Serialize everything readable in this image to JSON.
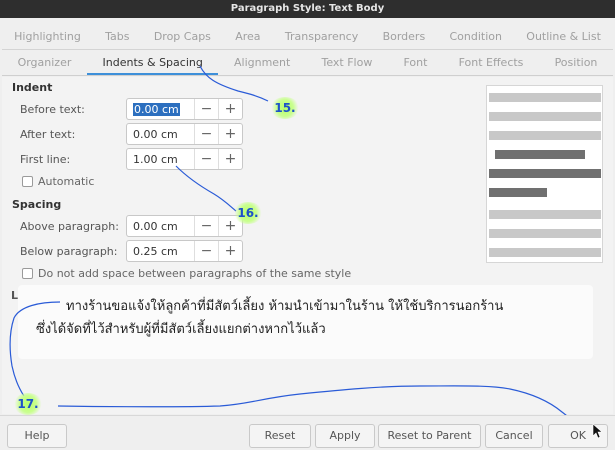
{
  "window": {
    "title": "Paragraph Style: Text Body"
  },
  "tabs_row1": [
    "Highlighting",
    "Tabs",
    "Drop Caps",
    "Area",
    "Transparency",
    "Borders",
    "Condition",
    "Outline & List"
  ],
  "tabs_row2": [
    "Organizer",
    "Indents & Spacing",
    "Alignment",
    "Text Flow",
    "Font",
    "Font Effects",
    "Position"
  ],
  "active_tab": "Indents & Spacing",
  "indent": {
    "heading": "Indent",
    "before_text": {
      "label": "Before text:",
      "value": "0.00 cm"
    },
    "after_text": {
      "label": "After text:",
      "value": "0.00 cm"
    },
    "first_line": {
      "label": "First line:",
      "value": "1.00 cm"
    },
    "automatic": {
      "label": "Automatic",
      "checked": false
    }
  },
  "spacing": {
    "heading": "Spacing",
    "above": {
      "label": "Above paragraph:",
      "value": "0.00 cm"
    },
    "below": {
      "label": "Below paragraph:",
      "value": "0.25 cm"
    },
    "no_space": {
      "label": "Do not add space between paragraphs of the same style",
      "checked": false
    }
  },
  "line_spacing_heading_partial": "L",
  "spin_minus": "−",
  "spin_plus": "+",
  "notice": {
    "line1": "ทางร้านขอแจ้งให้ลูกค้าที่มีสัตว์เลี้ยง ห้ามนำเข้ามาในร้าน ให้ใช้บริการนอกร้าน",
    "line2": "ซึ่งได้จัดที่ไว้สำหรับผู้ที่มีสัตว์เลี้ยงแยกต่างหากไว้แล้ว"
  },
  "annotations": {
    "a15": "15.",
    "a16": "16.",
    "a17": "17."
  },
  "annotation_color": "#2a5bd7",
  "accent_color": "#3d8fd9",
  "footer": {
    "help": "Help",
    "reset": "Reset",
    "apply": "Apply",
    "reset_to_parent": "Reset to Parent",
    "cancel": "Cancel",
    "ok": "OK"
  }
}
